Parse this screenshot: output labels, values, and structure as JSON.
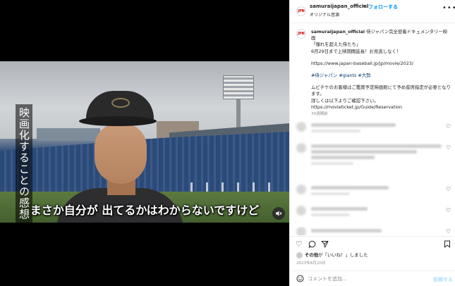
{
  "video": {
    "vertical_caption": "映画化することの感想",
    "subtitle": "まさか自分が 出てるかはわからないですけど",
    "mute_icon": "speaker-muted-icon"
  },
  "header": {
    "username": "samuraijapan_official",
    "dot": "•",
    "follow_label": "フォローする",
    "audio_label": "オリジナル音源",
    "more_icon": "more-horizontal-icon"
  },
  "caption": {
    "username": "samuraijapan_official",
    "line1": "侍ジャパン完全密着ドキュメンタリー映画",
    "line2": "「憧れを超えた侍たち」",
    "line3": "6月29日まで上映期間延長！お見逃しなく！",
    "url": "https://www.japan-baseball.jp/jp/movie/2023/",
    "tags": "#侍ジャパン #giants #大勢",
    "line4": "ムビチケのお客様はご鑑賞予定映画館にて予め座席指定が必要となります。",
    "line5": "詳しくは以下よりご確認下さい。",
    "url2": "https://movieticket.jp/Guide/Reservation",
    "time": "39週間前"
  },
  "actions": {
    "like_icon": "heart-icon",
    "comment_icon": "comment-icon",
    "share_icon": "send-icon",
    "save_icon": "bookmark-icon"
  },
  "likes": {
    "suffix": "その他",
    "text": "が「いいね！」しました"
  },
  "post_date": "2023年6月20日",
  "comment_box": {
    "emoji_icon": "smiley-icon",
    "placeholder": "コメントを追加...",
    "post_label": "投稿する"
  }
}
